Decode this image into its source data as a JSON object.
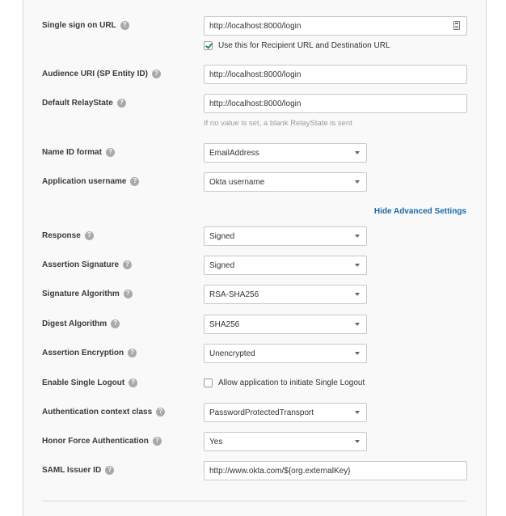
{
  "fields": {
    "sso_url": {
      "label": "Single sign on URL",
      "value": "http://localhost:8000/login"
    },
    "recipient_checkbox": {
      "label": "Use this for Recipient URL and Destination URL",
      "checked": true
    },
    "audience_uri": {
      "label": "Audience URI (SP Entity ID)",
      "value": "http://localhost:8000/login"
    },
    "default_relaystate": {
      "label": "Default RelayState",
      "value": "http://localhost:8000/login",
      "hint": "If no value is set, a blank RelayState is sent"
    },
    "name_id_format": {
      "label": "Name ID format",
      "value": "EmailAddress"
    },
    "app_username": {
      "label": "Application username",
      "value": "Okta username"
    },
    "advanced_link": "Hide Advanced Settings",
    "response": {
      "label": "Response",
      "value": "Signed"
    },
    "assertion_signature": {
      "label": "Assertion Signature",
      "value": "Signed"
    },
    "signature_algorithm": {
      "label": "Signature Algorithm",
      "value": "RSA-SHA256"
    },
    "digest_algorithm": {
      "label": "Digest Algorithm",
      "value": "SHA256"
    },
    "assertion_encryption": {
      "label": "Assertion Encryption",
      "value": "Unencrypted"
    },
    "single_logout": {
      "label": "Enable Single Logout",
      "checkbox_label": "Allow application to initiate Single Logout",
      "checked": false
    },
    "auth_context_class": {
      "label": "Authentication context class",
      "value": "PasswordProtectedTransport"
    },
    "honor_force_auth": {
      "label": "Honor Force Authentication",
      "value": "Yes"
    },
    "saml_issuer_id": {
      "label": "SAML Issuer ID",
      "value": "http://www.okta.com/${org.externalKey}"
    }
  },
  "help_glyph": "?",
  "colors": {
    "link": "#1a6aa8",
    "check": "#2e8b57",
    "panel_bg": "#f9f9f9"
  }
}
